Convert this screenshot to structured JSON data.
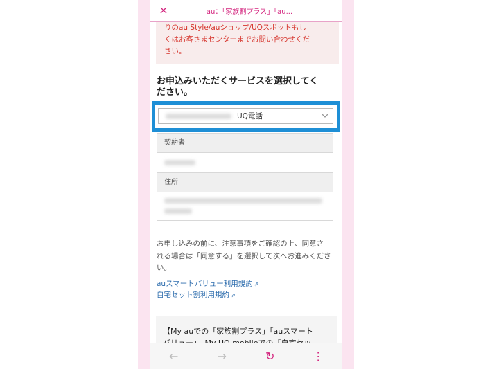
{
  "topbar": {
    "close_glyph": "×",
    "tab_title": "au：「家族割プラス」「au..."
  },
  "notice": {
    "lines": [
      "りのau Style/auショップ/UQスポットもし",
      "くはお客さまセンターまでお問い合わせくだ",
      "さい。"
    ]
  },
  "section": {
    "heading_line1": "お申込みいただくサービスを選択してく",
    "heading_line2": "ださい。"
  },
  "service_select": {
    "selected_value": "UQ電話"
  },
  "contract_info": {
    "holder_label": "契約者",
    "address_label": "住所"
  },
  "consent": {
    "lines": [
      "お申し込みの前に、注意事項をご確認の上、同意さ",
      "れる場合は「同意する」を選択して次へお進みくださ",
      "い。"
    ]
  },
  "terms_links": [
    {
      "label": "auスマートバリュー利用規約"
    },
    {
      "label": "自宅セット割利用規約"
    }
  ],
  "promo": {
    "lines": [
      "【My auでの「家族割プラス」「auスマート",
      "バリュー」、My UQ mobileでの「自宅セッ"
    ]
  },
  "bottom_nav": {
    "back_glyph": "←",
    "forward_glyph": "→",
    "reload_glyph": "↻",
    "menu_glyph": "⋮"
  },
  "colors": {
    "brand_pink": "#d3237d",
    "highlight_blue": "#1e8fd6",
    "notice_red": "#d6342c",
    "link_blue": "#2f6eae"
  }
}
